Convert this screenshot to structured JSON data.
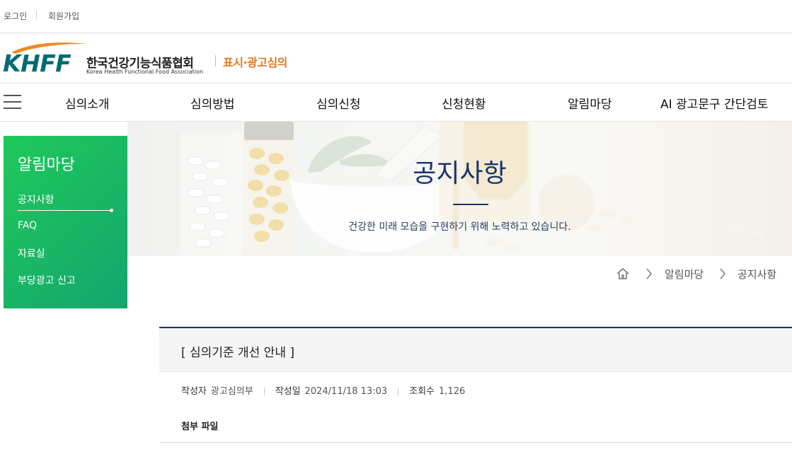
{
  "utility": {
    "login": "로그인",
    "join": "회원가입"
  },
  "logo": {
    "mark": "KHFF",
    "name_ko": "한국건강기능식품협회",
    "name_en": "Korea Health Functional Food Association",
    "service": "표시·광고심의",
    "colors": {
      "mark": "#006a73",
      "swoosh": "#f08a24",
      "service": "#e07a1f"
    }
  },
  "nav": {
    "menu_icon": "hamburger-icon",
    "items": [
      "심의소개",
      "심의방법",
      "심의신청",
      "신청현황",
      "알림마당",
      "AI 광고문구 간단검토"
    ]
  },
  "sidebar": {
    "title": "알림마당",
    "items": [
      "공지사항",
      "FAQ",
      "자료실",
      "부당광고 신고"
    ],
    "active": "공지사항",
    "color": "#1fc95a"
  },
  "banner": {
    "title": "공지사항",
    "subtitle": "건강한 미래 모습을 구현하기 위해 노력하고 있습니다."
  },
  "breadcrumb": {
    "home_icon": "home-icon",
    "items": [
      "알림마당",
      "공지사항"
    ]
  },
  "article": {
    "title": "[ 심의기준 개선 안내 ]",
    "author_label": "작성자",
    "author": "광고심의부",
    "date_label": "작성일",
    "date": "2024/11/18 13:03",
    "views_label": "조회수",
    "views": "1,126",
    "attach_label": "첨부 파일"
  }
}
